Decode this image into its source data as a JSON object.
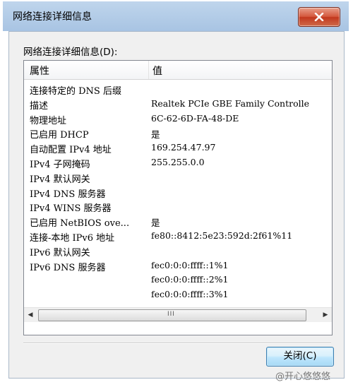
{
  "window": {
    "title": "网络连接详细信息"
  },
  "group_label": "网络连接详细信息(D):",
  "list": {
    "columns": [
      "属性",
      "值"
    ],
    "rows": [
      {
        "property": "连接特定的 DNS 后缀",
        "value": ""
      },
      {
        "property": "描述",
        "value": "Realtek PCIe GBE Family Controlle"
      },
      {
        "property": "物理地址",
        "value": "6C-62-6D-FA-48-DE"
      },
      {
        "property": "已启用 DHCP",
        "value": "是"
      },
      {
        "property": "自动配置 IPv4 地址",
        "value": "169.254.47.97"
      },
      {
        "property": "IPv4 子网掩码",
        "value": "255.255.0.0"
      },
      {
        "property": "IPv4 默认网关",
        "value": ""
      },
      {
        "property": "IPv4 DNS 服务器",
        "value": ""
      },
      {
        "property": "IPv4 WINS 服务器",
        "value": ""
      },
      {
        "property": "已启用 NetBIOS ove...",
        "value": "是"
      },
      {
        "property": "连接-本地 IPv6 地址",
        "value": "fe80::8412:5e23:592d:2f61%11"
      },
      {
        "property": "IPv6 默认网关",
        "value": ""
      },
      {
        "property": "IPv6 DNS 服务器",
        "value": "fec0:0:0:ffff::1%1"
      },
      {
        "property": "",
        "value": "fec0:0:0:ffff::2%1"
      },
      {
        "property": "",
        "value": "fec0:0:0:ffff::3%1"
      }
    ]
  },
  "scrollbar": {
    "left_arrow": "◀",
    "right_arrow": "▶",
    "grip": "III"
  },
  "buttons": {
    "close_label": "关闭(C)"
  },
  "watermark": {
    "text": "@开心悠悠悠"
  }
}
